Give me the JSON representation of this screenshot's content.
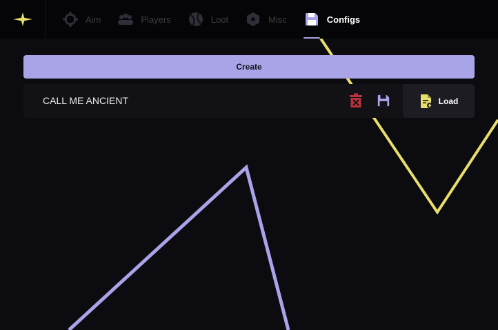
{
  "colors": {
    "accent": "#a9a3e8",
    "yellow": "#e8df6a",
    "background": "#0b0b10",
    "delete_red": "#b8323a"
  },
  "app": {
    "logo_icon": "star-icon"
  },
  "tabs": [
    {
      "label": "Aim",
      "icon": "crosshair-icon",
      "active": false
    },
    {
      "label": "Players",
      "icon": "group-icon",
      "active": false
    },
    {
      "label": "Loot",
      "icon": "ball-icon",
      "active": false
    },
    {
      "label": "Misc",
      "icon": "hexagon-gear-icon",
      "active": false
    },
    {
      "label": "Configs",
      "icon": "floppy-disk-icon",
      "active": true
    }
  ],
  "configs": {
    "create_label": "Create",
    "items": [
      {
        "name": "CALL ME ANCIENT",
        "load_label": "Load"
      }
    ]
  }
}
